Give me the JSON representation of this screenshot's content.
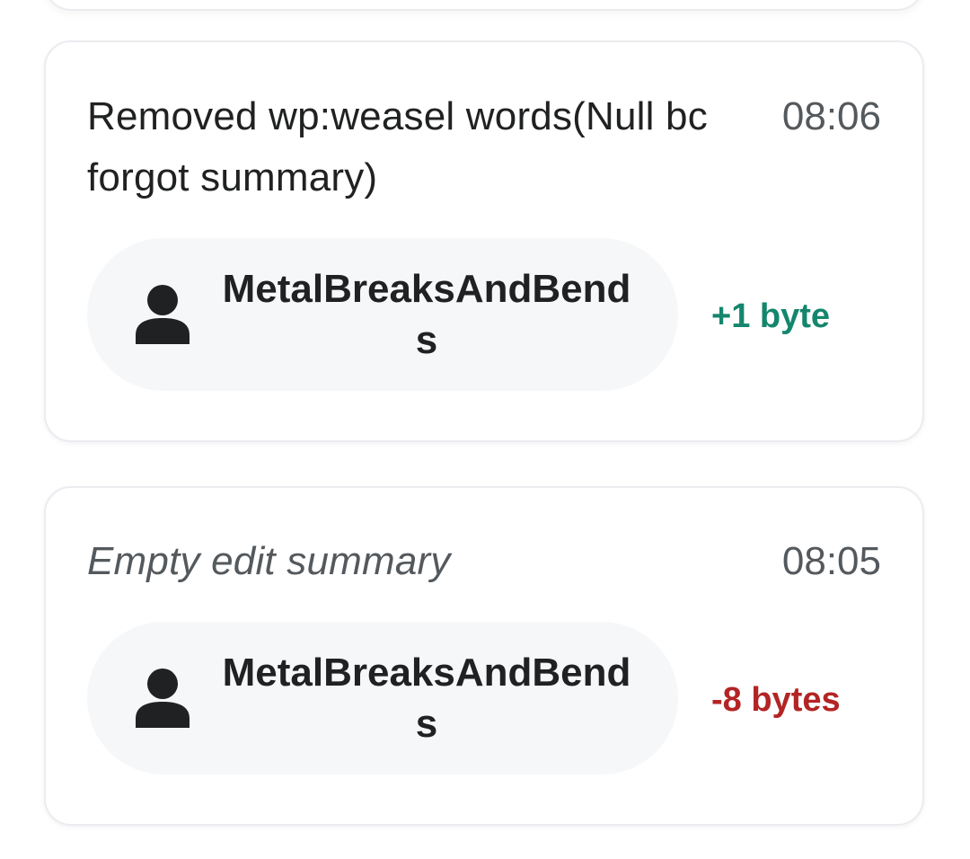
{
  "revisions": [
    {
      "summary": "Removed wp:weasel words(Null bc forgot summary)",
      "time": "08:06",
      "user": "MetalBreaksAndBends",
      "size_change": "+1 byte",
      "size_color": "#14866d"
    },
    {
      "summary": "Empty edit summary",
      "time": "08:05",
      "user": "MetalBreaksAndBends",
      "size_change": "-8 bytes",
      "size_color": "#b32424"
    }
  ],
  "icons": {
    "user": "user-avatar-icon"
  }
}
